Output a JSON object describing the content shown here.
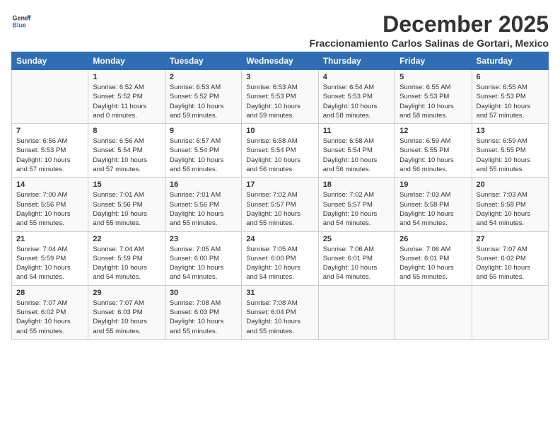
{
  "logo": {
    "line1": "General",
    "line2": "Blue"
  },
  "title": "December 2025",
  "location": "Fraccionamiento Carlos Salinas de Gortari, Mexico",
  "days_of_week": [
    "Sunday",
    "Monday",
    "Tuesday",
    "Wednesday",
    "Thursday",
    "Friday",
    "Saturday"
  ],
  "weeks": [
    [
      {
        "day": "",
        "info": ""
      },
      {
        "day": "1",
        "info": "Sunrise: 6:52 AM\nSunset: 5:52 PM\nDaylight: 11 hours\nand 0 minutes."
      },
      {
        "day": "2",
        "info": "Sunrise: 6:53 AM\nSunset: 5:52 PM\nDaylight: 10 hours\nand 59 minutes."
      },
      {
        "day": "3",
        "info": "Sunrise: 6:53 AM\nSunset: 5:53 PM\nDaylight: 10 hours\nand 59 minutes."
      },
      {
        "day": "4",
        "info": "Sunrise: 6:54 AM\nSunset: 5:53 PM\nDaylight: 10 hours\nand 58 minutes."
      },
      {
        "day": "5",
        "info": "Sunrise: 6:55 AM\nSunset: 5:53 PM\nDaylight: 10 hours\nand 58 minutes."
      },
      {
        "day": "6",
        "info": "Sunrise: 6:55 AM\nSunset: 5:53 PM\nDaylight: 10 hours\nand 57 minutes."
      }
    ],
    [
      {
        "day": "7",
        "info": "Sunrise: 6:56 AM\nSunset: 5:53 PM\nDaylight: 10 hours\nand 57 minutes."
      },
      {
        "day": "8",
        "info": "Sunrise: 6:56 AM\nSunset: 5:54 PM\nDaylight: 10 hours\nand 57 minutes."
      },
      {
        "day": "9",
        "info": "Sunrise: 6:57 AM\nSunset: 5:54 PM\nDaylight: 10 hours\nand 56 minutes."
      },
      {
        "day": "10",
        "info": "Sunrise: 6:58 AM\nSunset: 5:54 PM\nDaylight: 10 hours\nand 56 minutes."
      },
      {
        "day": "11",
        "info": "Sunrise: 6:58 AM\nSunset: 5:54 PM\nDaylight: 10 hours\nand 56 minutes."
      },
      {
        "day": "12",
        "info": "Sunrise: 6:59 AM\nSunset: 5:55 PM\nDaylight: 10 hours\nand 56 minutes."
      },
      {
        "day": "13",
        "info": "Sunrise: 6:59 AM\nSunset: 5:55 PM\nDaylight: 10 hours\nand 55 minutes."
      }
    ],
    [
      {
        "day": "14",
        "info": "Sunrise: 7:00 AM\nSunset: 5:56 PM\nDaylight: 10 hours\nand 55 minutes."
      },
      {
        "day": "15",
        "info": "Sunrise: 7:01 AM\nSunset: 5:56 PM\nDaylight: 10 hours\nand 55 minutes."
      },
      {
        "day": "16",
        "info": "Sunrise: 7:01 AM\nSunset: 5:56 PM\nDaylight: 10 hours\nand 55 minutes."
      },
      {
        "day": "17",
        "info": "Sunrise: 7:02 AM\nSunset: 5:57 PM\nDaylight: 10 hours\nand 55 minutes."
      },
      {
        "day": "18",
        "info": "Sunrise: 7:02 AM\nSunset: 5:57 PM\nDaylight: 10 hours\nand 54 minutes."
      },
      {
        "day": "19",
        "info": "Sunrise: 7:03 AM\nSunset: 5:58 PM\nDaylight: 10 hours\nand 54 minutes."
      },
      {
        "day": "20",
        "info": "Sunrise: 7:03 AM\nSunset: 5:58 PM\nDaylight: 10 hours\nand 54 minutes."
      }
    ],
    [
      {
        "day": "21",
        "info": "Sunrise: 7:04 AM\nSunset: 5:59 PM\nDaylight: 10 hours\nand 54 minutes."
      },
      {
        "day": "22",
        "info": "Sunrise: 7:04 AM\nSunset: 5:59 PM\nDaylight: 10 hours\nand 54 minutes."
      },
      {
        "day": "23",
        "info": "Sunrise: 7:05 AM\nSunset: 6:00 PM\nDaylight: 10 hours\nand 54 minutes."
      },
      {
        "day": "24",
        "info": "Sunrise: 7:05 AM\nSunset: 6:00 PM\nDaylight: 10 hours\nand 54 minutes."
      },
      {
        "day": "25",
        "info": "Sunrise: 7:06 AM\nSunset: 6:01 PM\nDaylight: 10 hours\nand 54 minutes."
      },
      {
        "day": "26",
        "info": "Sunrise: 7:06 AM\nSunset: 6:01 PM\nDaylight: 10 hours\nand 55 minutes."
      },
      {
        "day": "27",
        "info": "Sunrise: 7:07 AM\nSunset: 6:02 PM\nDaylight: 10 hours\nand 55 minutes."
      }
    ],
    [
      {
        "day": "28",
        "info": "Sunrise: 7:07 AM\nSunset: 6:02 PM\nDaylight: 10 hours\nand 55 minutes."
      },
      {
        "day": "29",
        "info": "Sunrise: 7:07 AM\nSunset: 6:03 PM\nDaylight: 10 hours\nand 55 minutes."
      },
      {
        "day": "30",
        "info": "Sunrise: 7:08 AM\nSunset: 6:03 PM\nDaylight: 10 hours\nand 55 minutes."
      },
      {
        "day": "31",
        "info": "Sunrise: 7:08 AM\nSunset: 6:04 PM\nDaylight: 10 hours\nand 55 minutes."
      },
      {
        "day": "",
        "info": ""
      },
      {
        "day": "",
        "info": ""
      },
      {
        "day": "",
        "info": ""
      }
    ]
  ]
}
